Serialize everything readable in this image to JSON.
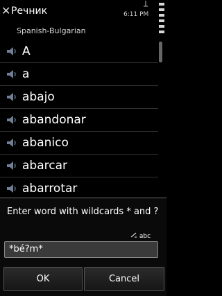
{
  "header": {
    "title": "Речник",
    "subtitle": "Spanish-Bulgarian",
    "clock": "6:11 PM",
    "close_icon": "close-icon"
  },
  "words": [
    {
      "text": "A",
      "icon": "speaker-icon"
    },
    {
      "text": "a",
      "icon": "speaker-icon"
    },
    {
      "text": "abajo",
      "icon": "speaker-icon"
    },
    {
      "text": "abandonar",
      "icon": "speaker-icon"
    },
    {
      "text": "abanico",
      "icon": "speaker-icon"
    },
    {
      "text": "abarcar",
      "icon": "speaker-icon"
    },
    {
      "text": "abarrotar",
      "icon": "speaker-icon"
    }
  ],
  "dialog": {
    "prompt": "Enter word with wildcards * and ?",
    "input_mode": "abc",
    "input_value": "*bé?m*",
    "ok_label": "OK",
    "cancel_label": "Cancel"
  },
  "colors": {
    "background": "#000000",
    "row_divider": "#323232",
    "input_bg": "#3a3a3a"
  }
}
